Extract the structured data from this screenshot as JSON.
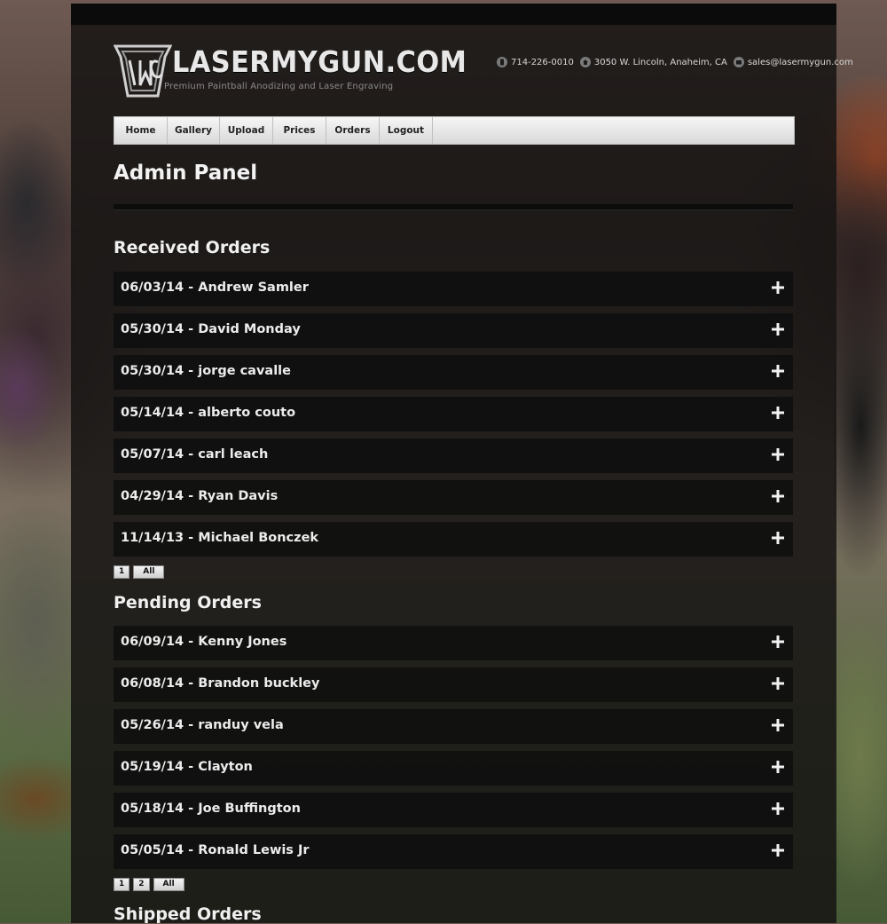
{
  "site": {
    "brand": "LASERMYGUN.COM",
    "tagline": "Premium Paintball Anodizing and Laser Engraving",
    "phone": "714-226-0010",
    "address": "3050 W. Lincoln, Anaheim, CA",
    "email": "sales@lasermygun.com"
  },
  "nav": [
    {
      "label": "Home"
    },
    {
      "label": "Gallery"
    },
    {
      "label": "Upload"
    },
    {
      "label": "Prices"
    },
    {
      "label": "Orders"
    },
    {
      "label": "Logout"
    }
  ],
  "page": {
    "title": "Admin Panel"
  },
  "received": {
    "title": "Received Orders",
    "orders": [
      "06/03/14 - Andrew Samler",
      "05/30/14 - David Monday",
      "05/30/14 - jorge cavalle",
      "05/14/14 - alberto couto",
      "05/07/14 - carl leach",
      "04/29/14 - Ryan Davis",
      "11/14/13 - Michael Bonczek"
    ],
    "pages": [
      "1",
      "All"
    ]
  },
  "pending": {
    "title": "Pending Orders",
    "orders": [
      "06/09/14 - Kenny Jones",
      "06/08/14 - Brandon buckley",
      "05/26/14 - randuy vela",
      "05/19/14 - Clayton",
      "05/18/14 - Joe Buffington",
      "05/05/14 - Ronald Lewis Jr"
    ],
    "pages": [
      "1",
      "2",
      "All"
    ]
  },
  "shipped": {
    "title": "Shipped Orders"
  },
  "icons": {
    "phone": "phone-icon",
    "address": "home-icon",
    "email": "mail-icon",
    "expand": "plus-icon"
  },
  "colors": {
    "panel": "#181615",
    "row": "#101010",
    "text": "#ececec"
  }
}
